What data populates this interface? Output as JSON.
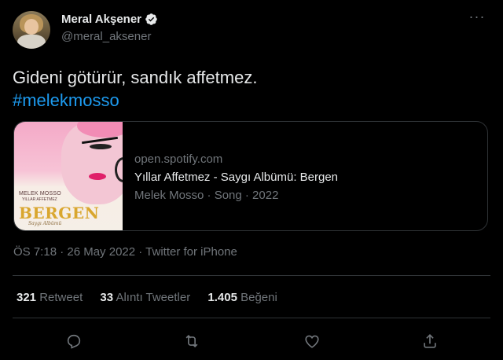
{
  "author": {
    "display_name": "Meral Akşener",
    "handle": "@meral_aksener",
    "verified": true
  },
  "tweet": {
    "text": "Gideni götürür, sandık affetmez.",
    "hashtag": "#melekmosso"
  },
  "card": {
    "image": {
      "artist_small": "MELEK MOSSO",
      "subtitle_small": "YILLAR AFFETMEZ",
      "title": "BERGEN",
      "caption": "Saygı Albümü"
    },
    "domain": "open.spotify.com",
    "title": "Yıllar Affetmez - Saygı Albümü: Bergen",
    "description": "Melek Mosso · Song · 2022"
  },
  "meta": {
    "timestamp": "ÖS 7:18 · 26 May 2022 · Twitter for iPhone"
  },
  "stats": {
    "retweets_count": "321",
    "retweets_label": "Retweet",
    "quotes_count": "33",
    "quotes_label": "Alıntı Tweetler",
    "likes_count": "1.405",
    "likes_label": "Beğeni"
  },
  "colors": {
    "background": "#000000",
    "text": "#e7e9ea",
    "secondary": "#71767b",
    "accent": "#1d9bf0",
    "border": "#2f3336"
  },
  "actions": [
    "reply-icon",
    "retweet-icon",
    "like-icon",
    "share-icon"
  ]
}
